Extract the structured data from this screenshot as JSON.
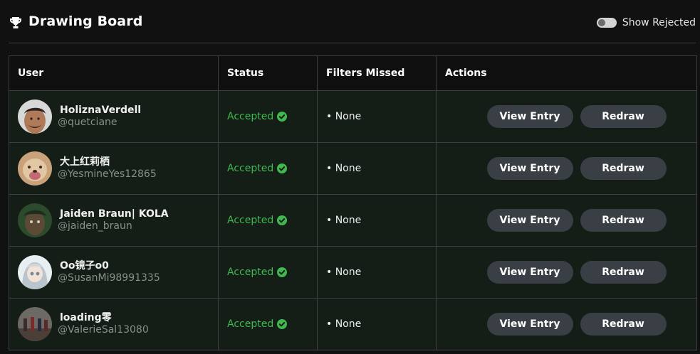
{
  "header": {
    "title": "Drawing Board",
    "trophy_icon": "trophy-icon",
    "toggle": {
      "label": "Show Rejected",
      "checked": false
    }
  },
  "table": {
    "columns": [
      "User",
      "Status",
      "Filters Missed",
      "Actions"
    ],
    "rows": [
      {
        "name": "HoliznaVerdell",
        "handle": "@quetciane",
        "status": "Accepted",
        "filters": "• None",
        "view": "View Entry",
        "redraw": "Redraw"
      },
      {
        "name": "大上红莉栖",
        "handle": "@YesmineYes12865",
        "status": "Accepted",
        "filters": "• None",
        "view": "View Entry",
        "redraw": "Redraw"
      },
      {
        "name": "Jaiden Braun| KOLA",
        "handle": "@jaiden_braun",
        "status": "Accepted",
        "filters": "• None",
        "view": "View Entry",
        "redraw": "Redraw"
      },
      {
        "name": "Oo镜子o0",
        "handle": "@SusanMi98991335",
        "status": "Accepted",
        "filters": "• None",
        "view": "View Entry",
        "redraw": "Redraw"
      },
      {
        "name": "loading零",
        "handle": "@ValerieSal13080",
        "status": "Accepted",
        "filters": "• None",
        "view": "View Entry",
        "redraw": "Redraw"
      }
    ]
  },
  "colors": {
    "accepted": "#3fb950",
    "button_bg": "#3a3f45",
    "row_bg": "#141d16"
  }
}
